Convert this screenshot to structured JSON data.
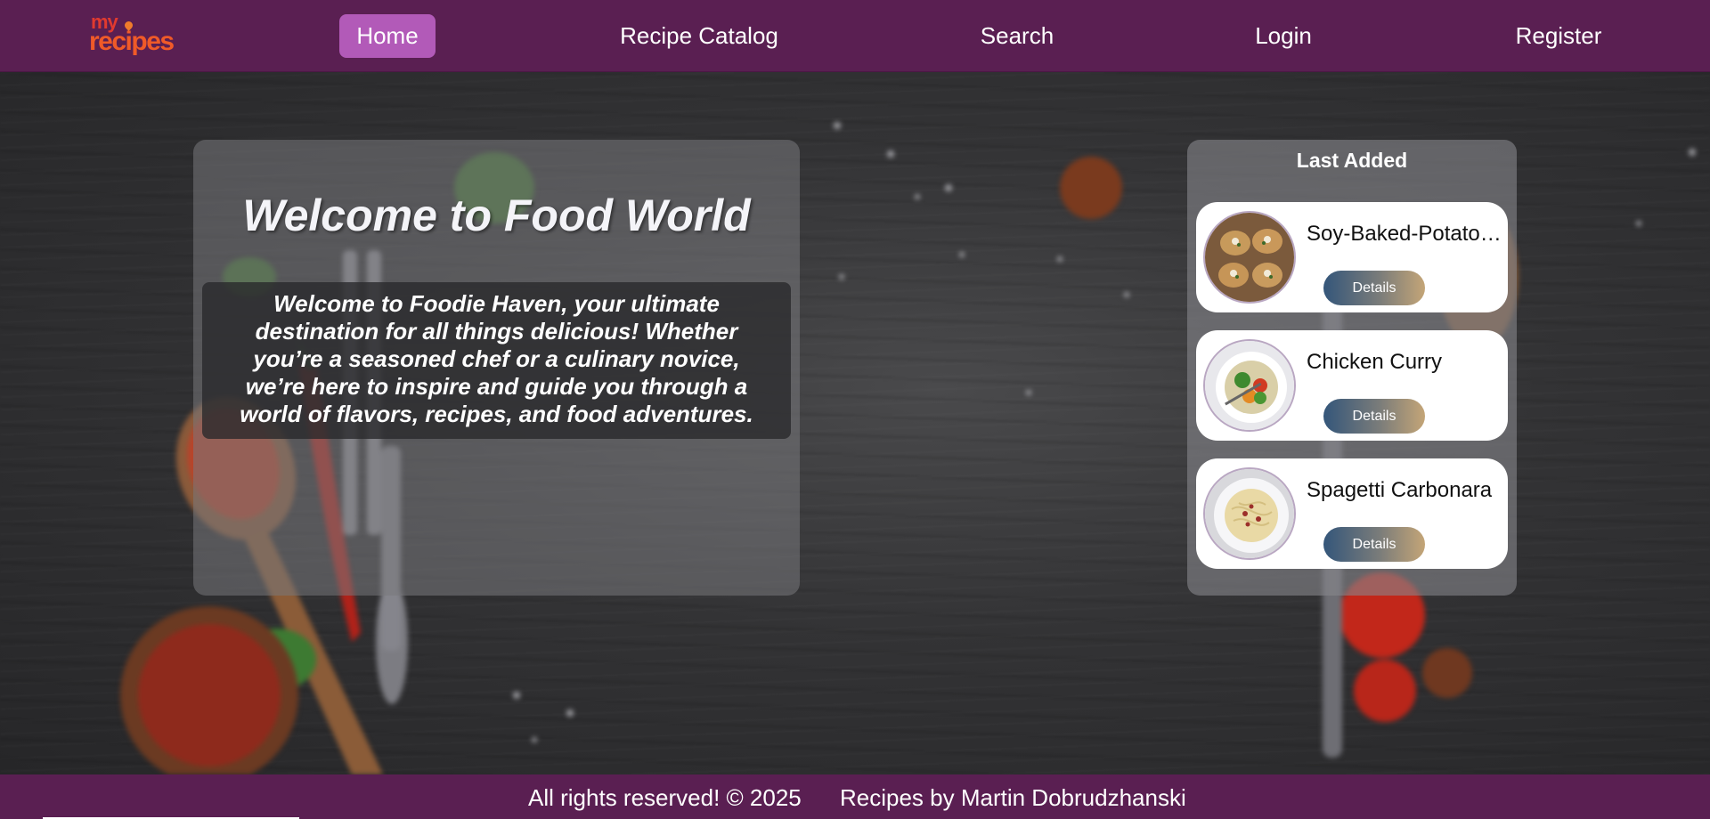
{
  "logo": {
    "line1": "my",
    "line2": "recipes"
  },
  "nav": {
    "items": [
      {
        "label": "Home",
        "active": true
      },
      {
        "label": "Recipe Catalog",
        "active": false
      },
      {
        "label": "Search",
        "active": false
      },
      {
        "label": "Login",
        "active": false
      },
      {
        "label": "Register",
        "active": false
      }
    ]
  },
  "welcome": {
    "heading": "Welcome to Food World",
    "intro": "Welcome to Foodie Haven, your ultimate destination for all things delicious! Whether you’re a seasoned chef or a culinary novice, we’re here to inspire and guide you through a world of flavors, recipes, and food adventures."
  },
  "last_added": {
    "title": "Last Added",
    "recipes": [
      {
        "name": "Soy-Baked-Potatoes",
        "button": "Details",
        "image": "baked-potatoes"
      },
      {
        "name": "Chicken Curry",
        "button": "Details",
        "image": "vegetable-bowl"
      },
      {
        "name": "Spagetti Carbonara",
        "button": "Details",
        "image": "pasta-plate"
      }
    ]
  },
  "footer": {
    "copyright": "All rights reserved! © 2025",
    "credit": "Recipes by Martin Dobrudzhanski"
  },
  "colors": {
    "header_bg": "#5a1f52",
    "nav_active_bg": "#b25ab8",
    "details_gradient_start": "#34567a",
    "details_gradient_end": "#c4a577"
  }
}
